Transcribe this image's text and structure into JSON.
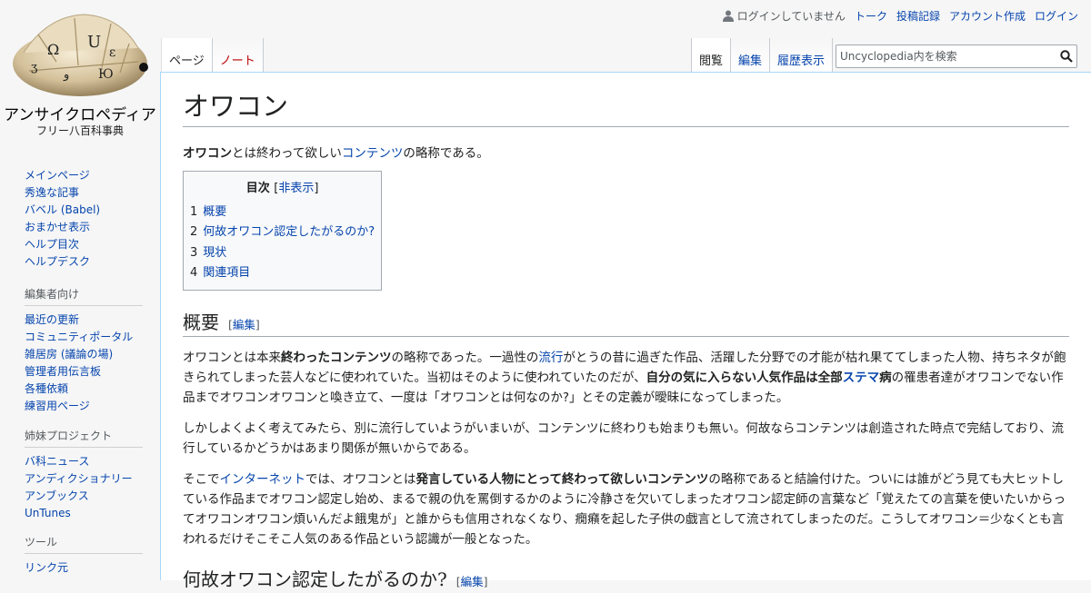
{
  "site": {
    "title": "アンサイクロペディア",
    "subtitle": "フリー八百科事典"
  },
  "personal": {
    "not_logged_in": "ログインしていません",
    "talk": "トーク",
    "contributions": "投稿記録",
    "create_account": "アカウント作成",
    "login": "ログイン"
  },
  "tabs": {
    "page": "ページ",
    "talk": "ノート",
    "read": "閲覧",
    "edit": "編集",
    "history": "履歴表示"
  },
  "search": {
    "placeholder": "Uncyclopedia内を検索"
  },
  "sidebar": {
    "nav": [
      "メインページ",
      "秀逸な記事",
      "バベル (Babel)",
      "おまかせ表示",
      "ヘルプ目次",
      "ヘルプデスク"
    ],
    "edit_heading": "編集者向け",
    "edit_items": [
      "最近の更新",
      "コミュニティポータル",
      "雑居房 (議論の場)",
      "管理者用伝言板",
      "各種依頼",
      "練習用ページ"
    ],
    "sister_heading": "姉妹プロジェクト",
    "sister_items": [
      "バ科ニュース",
      "アンディクショナリー",
      "アンブックス",
      "UnTunes"
    ],
    "tools_heading": "ツール",
    "tools_items": [
      "リンク元"
    ]
  },
  "article": {
    "title": "オワコン",
    "intro": {
      "bold": "オワコン",
      "t1": "とは終わって欲しい",
      "link": "コンテンツ",
      "t2": "の略称である。"
    },
    "toc": {
      "heading": "目次",
      "toggle": "非表示",
      "items": [
        {
          "num": "1",
          "label": "概要"
        },
        {
          "num": "2",
          "label": "何故オワコン認定したがるのか?"
        },
        {
          "num": "3",
          "label": "現状"
        },
        {
          "num": "4",
          "label": "関連項目"
        }
      ]
    },
    "edit_label": "編集",
    "section1": {
      "heading": "概要",
      "p1": {
        "a": "オワコンとは本来",
        "b": "終わったコンテンツ",
        "c": "の略称であった。一過性の",
        "link1": "流行",
        "d": "がとうの昔に過ぎた作品、活躍した分野での才能が枯れ果ててしまった人物、持ちネタが飽きられてしまった芸人などに使われていた。当初はそのように使われていたのだが、",
        "e": "自分の気に入らない人気作品は全部",
        "link2": "ステマ",
        "f": "病",
        "g": "の罹患者達がオワコンでない作品までオワコンオワコンと喚き立て、一度は「オワコンとは何なのか?」とその定義が曖昧になってしまった。"
      },
      "p2": "しかしよくよく考えてみたら、別に流行していようがいまいが、コンテンツに終わりも始まりも無い。何故ならコンテンツは創造された時点で完結しており、流行しているかどうかはあまり関係が無いからである。",
      "p3": {
        "a": "そこで",
        "link": "インターネット",
        "b": "では、オワコンとは",
        "bold": "発言している人物にとって終わって欲しいコンテンツ",
        "c": "の略称であると結論付けた。ついには誰がどう見ても大ヒットしている作品までオワコン認定し始め、まるで親の仇を罵倒するかのように冷静さを欠いてしまったオワコン認定師の言葉など「覚えたての言葉を使いたいからってオワコンオワコン煩いんだよ餓鬼が」と誰からも信用されなくなり、癇癪を起した子供の戯言として流されてしまったのだ。こうしてオワコン＝少なくとも言われるだけそこそこ人気のある作品という認識が一般となった。"
      }
    },
    "section2": {
      "heading": "何故オワコン認定したがるのか?"
    }
  },
  "colors": {
    "link": "#0645ad",
    "new_link": "#ba0000",
    "border": "#a7d7f9"
  }
}
